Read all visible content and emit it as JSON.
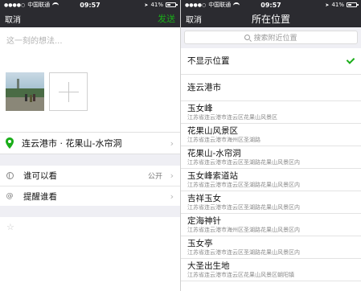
{
  "left": {
    "status": {
      "carrier": "中国联通",
      "time": "09:57",
      "battery": "41%"
    },
    "nav": {
      "cancel": "取消",
      "send": "发送"
    },
    "compose": {
      "placeholder": "这一刻的想法..."
    },
    "location": {
      "text": "连云港市 · 花果山-水帘洞"
    },
    "settings": [
      {
        "label": "谁可以看",
        "value": "公开"
      },
      {
        "label": "提醒谁看",
        "value": ""
      }
    ]
  },
  "right": {
    "status": {
      "carrier": "中国联通",
      "time": "09:57",
      "battery": "41%"
    },
    "nav": {
      "cancel": "取消",
      "title": "所在位置"
    },
    "search": {
      "placeholder": "搜索附近位置"
    },
    "none_option": "不显示位置",
    "places": [
      {
        "name": "连云港市",
        "address": ""
      },
      {
        "name": "玉女峰",
        "address": "江苏省连云港市连云区花果山风景区"
      },
      {
        "name": "花果山风景区",
        "address": "江苏省连云港市海州区圣湖路"
      },
      {
        "name": "花果山-水帘洞",
        "address": "江苏省连云港市连云区圣湖路花果山风景区内"
      },
      {
        "name": "玉女峰索道站",
        "address": "江苏省连云港市连云区圣湖路花果山风景区内"
      },
      {
        "name": "吉祥玉女",
        "address": "江苏省连云港市连云区圣湖路花果山风景区内"
      },
      {
        "name": "定海神针",
        "address": "江苏省连云港市海州区圣湖路花果山风景区内"
      },
      {
        "name": "玉女亭",
        "address": "江苏省连云港市连云区圣湖路花果山风景区内"
      },
      {
        "name": "大圣出生地",
        "address": "江苏省连云港市连云区花果山风景区朝阳镇"
      }
    ]
  },
  "colors": {
    "nav_bg": "#2b2b30",
    "accent_green": "#1aad19",
    "page_bg": "#efeff4"
  }
}
